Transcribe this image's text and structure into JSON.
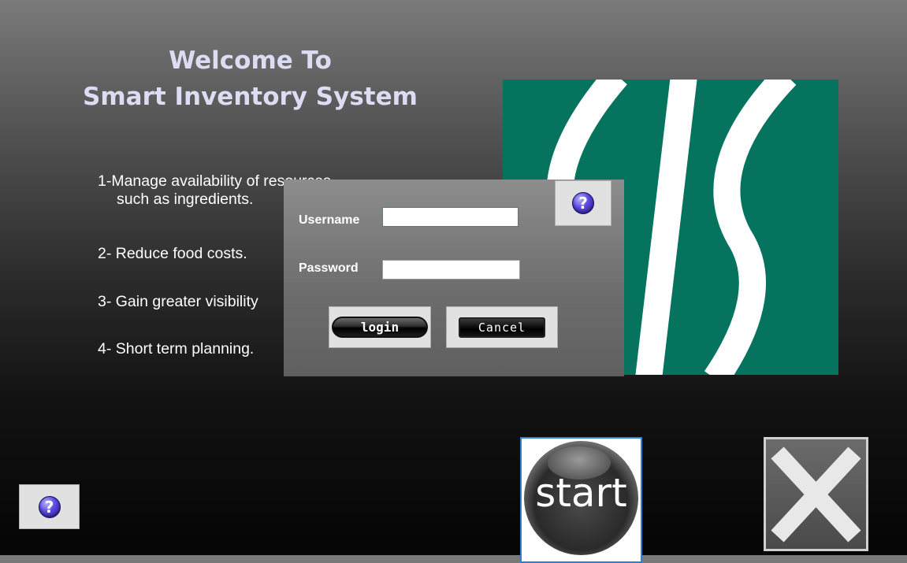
{
  "welcome": {
    "line1": "Welcome To",
    "line2": "Smart Inventory System"
  },
  "features": [
    {
      "line1": "1-Manage availability of resources",
      "line2": "such as ingredients."
    },
    {
      "line1": "2- Reduce food costs."
    },
    {
      "line1": "3- Gain greater visibility"
    },
    {
      "line1": "4- Short term planning."
    }
  ],
  "logo": {
    "text": "SIS",
    "colors": {
      "primary": "#05735d",
      "stripe": "#ffffff"
    }
  },
  "login_dialog": {
    "username_label": "Username",
    "username_value": "",
    "password_label": "Password",
    "password_value": "",
    "login_label": "login",
    "cancel_label": "Cancel",
    "help_icon": "help-question-icon"
  },
  "start_button": {
    "label": "start"
  },
  "exit_button": {
    "icon": "close-x-icon"
  },
  "bottom_help": {
    "icon": "help-question-icon"
  }
}
